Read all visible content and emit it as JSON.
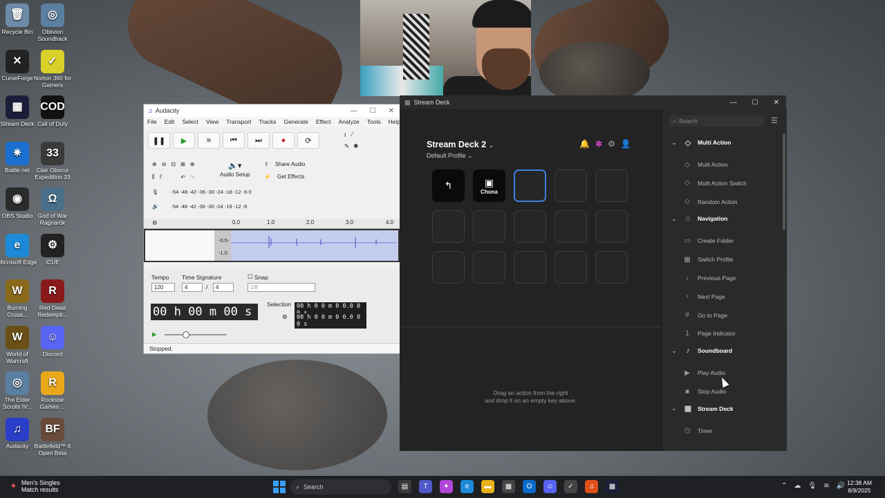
{
  "desktop": {
    "icons": [
      {
        "label": "Recycle Bin",
        "glyph": "🗑",
        "color": "#6d8aa8"
      },
      {
        "label": "Oblivion Soundtrack",
        "glyph": "◎",
        "color": "#5a7fa0"
      },
      {
        "label": "CurseForge",
        "glyph": "✕",
        "color": "#222"
      },
      {
        "label": "Norton 360 for Gamers",
        "glyph": "✓",
        "color": "#d9d12a"
      },
      {
        "label": "Stream Deck",
        "glyph": "▦",
        "color": "#1a1e3a"
      },
      {
        "label": "Call of Duty",
        "glyph": "COD",
        "color": "#111"
      },
      {
        "label": "Battle.net",
        "glyph": "✷",
        "color": "#1a6fd0"
      },
      {
        "label": "Clair Obscur Expedition 33",
        "glyph": "33",
        "color": "#3a3a3a"
      },
      {
        "label": "OBS Studio",
        "glyph": "◉",
        "color": "#2b2b2b"
      },
      {
        "label": "God of War Ragnarök",
        "glyph": "Ω",
        "color": "#4a6f8a"
      },
      {
        "label": "Microsoft Edge",
        "glyph": "e",
        "color": "#1c8ad8"
      },
      {
        "label": "iCUE",
        "glyph": "⚙",
        "color": "#222"
      },
      {
        "label": "Burning Crusa...",
        "glyph": "W",
        "color": "#8a6a1a"
      },
      {
        "label": "Red Dead Redempti...",
        "glyph": "R",
        "color": "#8a1a1a"
      },
      {
        "label": "World of Warcraft",
        "glyph": "W",
        "color": "#6a5016"
      },
      {
        "label": "Discord",
        "glyph": "☺",
        "color": "#5865f2"
      },
      {
        "label": "The Elder Scrolls IV...",
        "glyph": "◎",
        "color": "#5a7fa0"
      },
      {
        "label": "Rockstar Games ...",
        "glyph": "R",
        "color": "#e8a81a"
      },
      {
        "label": "Audacity",
        "glyph": "♫",
        "color": "#2a3ec8"
      },
      {
        "label": "Battlefield™ 6 Open Beta",
        "glyph": "BF",
        "color": "#6a4a3a"
      }
    ]
  },
  "audacity": {
    "title": "Audacity",
    "menu": [
      "File",
      "Edit",
      "Select",
      "View",
      "Transport",
      "Tracks",
      "Generate",
      "Effect",
      "Analyze",
      "Tools",
      "Help"
    ],
    "share_audio": "Share Audio",
    "audio_setup": "Audio Setup",
    "get_effects": "Get Effects",
    "meter_ticks": "-54 -48 -42 -36 -30 -24 -18 -12 -6 0",
    "meter_ticks_short": "-54 -48 -42 -36 -30 -24 -18 -12 -6",
    "ruler": [
      "0.0",
      "1.0",
      "2.0",
      "3.0",
      "4.0"
    ],
    "track_scale": [
      "-0.5-",
      "-1.0"
    ],
    "tempo_label": "Tempo",
    "tempo_value": "120",
    "time_sig_label": "Time Signature",
    "time_sig_num": "4",
    "time_sig_den": "4",
    "snap_label": "Snap",
    "snap_value": "1/8",
    "time_display": "00 h 00 m 00 s",
    "selection_label": "Selection",
    "sel_start": "00 h 0 0 m 0 0.0 0 0 s",
    "sel_end": "00 h 0 0 m 0 0.0 0 0 s",
    "status": "Stopped."
  },
  "streamdeck": {
    "title": "Stream Deck",
    "device": "Stream Deck 2",
    "profile": "Default Profile",
    "keys": [
      {
        "label": "",
        "icon": "↰",
        "style": "dark"
      },
      {
        "label": "Chona",
        "icon": "▣",
        "style": "dark"
      },
      {
        "label": "",
        "icon": "",
        "style": "sel"
      },
      {
        "label": "",
        "icon": "",
        "style": ""
      },
      {
        "label": "",
        "icon": "",
        "style": ""
      },
      {
        "label": "",
        "icon": "",
        "style": ""
      },
      {
        "label": "",
        "icon": "",
        "style": ""
      },
      {
        "label": "",
        "icon": "",
        "style": ""
      },
      {
        "label": "",
        "icon": "",
        "style": ""
      },
      {
        "label": "",
        "icon": "",
        "style": ""
      },
      {
        "label": "",
        "icon": "",
        "style": ""
      },
      {
        "label": "",
        "icon": "",
        "style": ""
      },
      {
        "label": "",
        "icon": "",
        "style": ""
      },
      {
        "label": "",
        "icon": "",
        "style": ""
      },
      {
        "label": "",
        "icon": "",
        "style": ""
      }
    ],
    "hint_line1": "Drag an action from the right",
    "hint_line2": "and drop it on an empty key above.",
    "search_placeholder": "Search",
    "actions": [
      {
        "type": "cat",
        "label": "Multi Action",
        "icon": "◇"
      },
      {
        "type": "item",
        "label": "Multi Action",
        "icon": "◇"
      },
      {
        "type": "item",
        "label": "Multi Action Switch",
        "icon": "◇"
      },
      {
        "type": "item",
        "label": "Random Action",
        "icon": "◇"
      },
      {
        "type": "cat",
        "label": "Navigation",
        "icon": "⌂"
      },
      {
        "type": "item",
        "label": "Create Folder",
        "icon": "▭"
      },
      {
        "type": "item",
        "label": "Switch Profile",
        "icon": "▦"
      },
      {
        "type": "item",
        "label": "Previous Page",
        "icon": "‹"
      },
      {
        "type": "item",
        "label": "Next Page",
        "icon": "›"
      },
      {
        "type": "item",
        "label": "Go to Page",
        "icon": "#"
      },
      {
        "type": "item",
        "label": "Page Indicator",
        "icon": "1"
      },
      {
        "type": "cat",
        "label": "Soundboard",
        "icon": "♪"
      },
      {
        "type": "item",
        "label": "Play Audio",
        "icon": "▶"
      },
      {
        "type": "item",
        "label": "Stop Audio",
        "icon": "■"
      },
      {
        "type": "cat",
        "label": "Stream Deck",
        "icon": "▦"
      },
      {
        "type": "item",
        "label": "Timer",
        "icon": "◷"
      }
    ]
  },
  "taskbar": {
    "weather_title": "Men's Singles",
    "weather_sub": "Match results",
    "search_label": "Search",
    "apps": [
      {
        "glyph": "▤",
        "color": "#3a3a3a"
      },
      {
        "glyph": "T",
        "color": "#5059c9"
      },
      {
        "glyph": "✦",
        "color": "#b046d8"
      },
      {
        "glyph": "e",
        "color": "#1c8ad8"
      },
      {
        "glyph": "▬",
        "color": "#e8b21a"
      },
      {
        "glyph": "▦",
        "color": "#444"
      },
      {
        "glyph": "O",
        "color": "#0a6ac8"
      },
      {
        "glyph": "☺",
        "color": "#5865f2"
      },
      {
        "glyph": "✓",
        "color": "#444"
      },
      {
        "glyph": "♫",
        "color": "#e0501a"
      },
      {
        "glyph": "▦",
        "color": "#1a1e3a"
      }
    ],
    "time": "12:38 AM",
    "date": "8/9/2025"
  }
}
